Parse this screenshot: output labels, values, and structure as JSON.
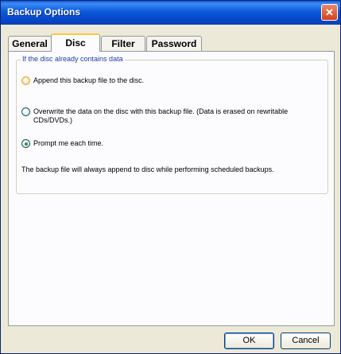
{
  "window": {
    "title": "Backup Options",
    "close_glyph": "✕"
  },
  "tabs": [
    {
      "label": "General"
    },
    {
      "label": "Disc"
    },
    {
      "label": "Filter"
    },
    {
      "label": "Password"
    }
  ],
  "active_tab": "Disc",
  "group": {
    "legend": "If the disc already contains data",
    "options": [
      {
        "label": "Append this backup file to the disc.",
        "checked": false
      },
      {
        "label": "Overwrite the data on the disc with this backup file. (Data is erased on rewritable CDs/DVDs.)",
        "checked": false
      },
      {
        "label": "Prompt me each time.",
        "checked": true
      }
    ],
    "note": "The backup file will always append to disc while performing scheduled backups."
  },
  "buttons": {
    "ok": "OK",
    "cancel": "Cancel"
  }
}
